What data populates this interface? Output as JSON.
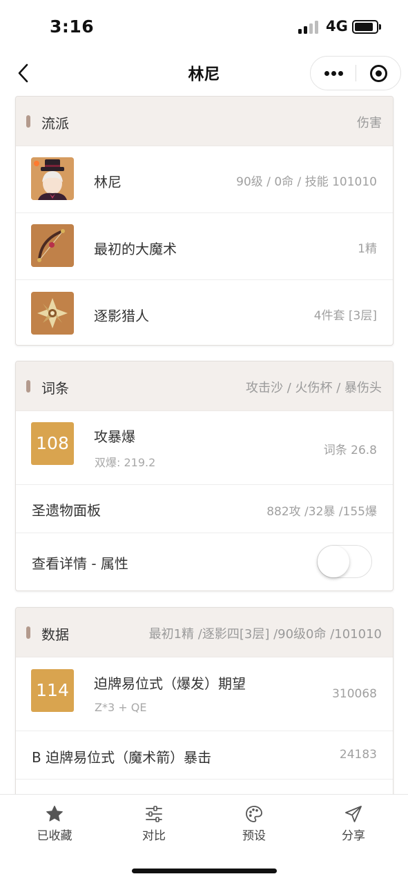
{
  "status_bar": {
    "time": "3:16",
    "network": "4G",
    "signal_bars": 4,
    "signal_bars_active": 2,
    "battery_level": 0.85
  },
  "nav": {
    "title": "林尼",
    "back_icon": "chevron-left-icon",
    "more_icon": "more-dots-icon",
    "close_icon": "target-circle-icon"
  },
  "build_card": {
    "title": "流派",
    "right": "伤害",
    "items": [
      {
        "name": "林尼",
        "detail": "90级 / 0命 / 技能 101010",
        "icon": "character-lyney-icon"
      },
      {
        "name": "最初的大魔术",
        "detail": "1精",
        "icon": "bow-weapon-icon"
      },
      {
        "name": "逐影猎人",
        "detail": "4件套 [3层]",
        "icon": "artifact-flower-icon"
      }
    ]
  },
  "stats_card": {
    "title": "词条",
    "right": "攻击沙 / 火伤杯 / 暴伤头",
    "score": "108",
    "score_name": "攻暴爆",
    "score_sub": "双爆: 219.2",
    "score_right": "词条 26.8",
    "panel_label": "圣遗物面板",
    "panel_value": "882攻 /32暴 /155爆",
    "detail_label": "查看详情 - 属性",
    "detail_toggle_on": false
  },
  "data_card": {
    "title": "数据",
    "right": "最初1精 /逐影四[3层] /90级0命 /101010",
    "score": "114",
    "score_name": "迫牌易位式（爆发）期望",
    "score_sub": "Z*3 + QE",
    "score_right": "310068",
    "row2_label": "B 迫牌易位式（魔术箭）暴击",
    "row2_value": "24183"
  },
  "tabs": [
    {
      "label": "已收藏",
      "icon": "star-icon"
    },
    {
      "label": "对比",
      "icon": "sliders-icon"
    },
    {
      "label": "预设",
      "icon": "palette-icon"
    },
    {
      "label": "分享",
      "icon": "send-icon"
    }
  ],
  "colors": {
    "accent_gold": "#d9a44f",
    "header_bg": "#f3efec",
    "header_bar": "#b39a8d"
  }
}
